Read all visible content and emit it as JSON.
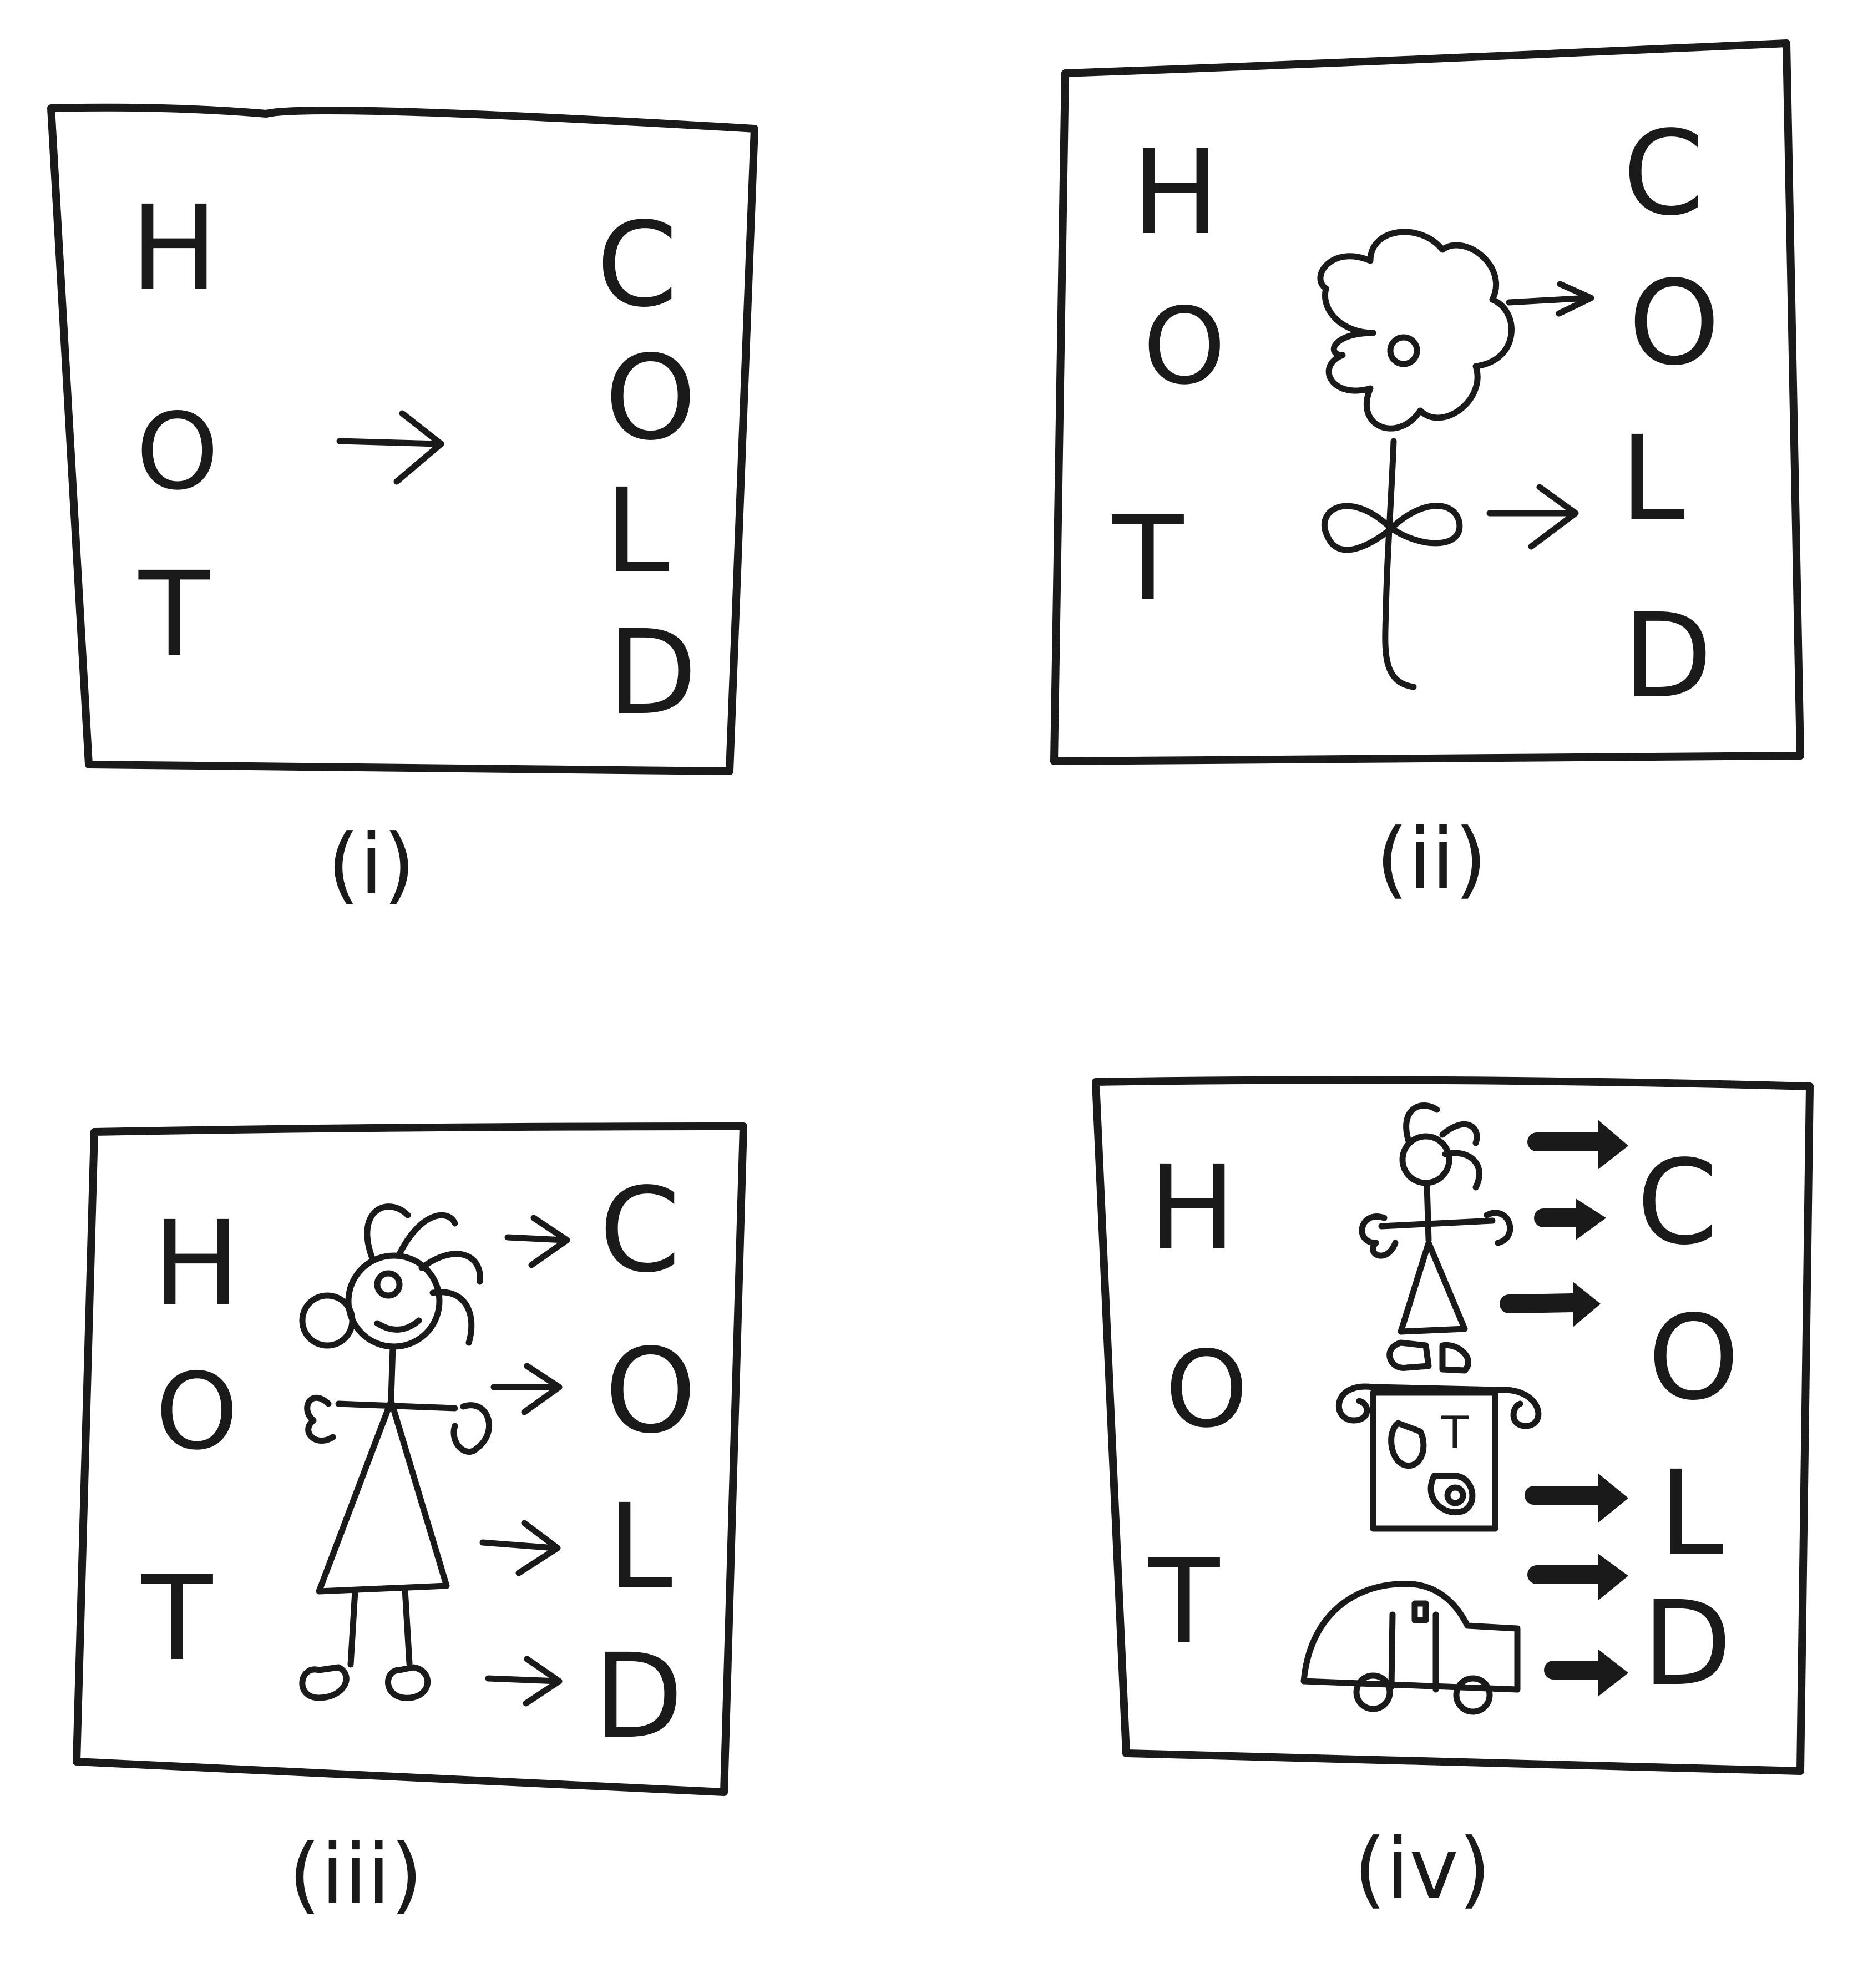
{
  "panels": [
    {
      "id": "i",
      "caption": "(i)",
      "left_letters": [
        "H",
        "O",
        "T"
      ],
      "right_letters": [
        "C",
        "O",
        "L",
        "D"
      ]
    },
    {
      "id": "ii",
      "caption": "(ii)",
      "left_letters": [
        "H",
        "O",
        "T"
      ],
      "right_letters": [
        "C",
        "O",
        "L",
        "D"
      ]
    },
    {
      "id": "iii",
      "caption": "(iii)",
      "left_letters": [
        "H",
        "O",
        "T"
      ],
      "right_letters": [
        "C",
        "O",
        "L",
        "D"
      ]
    },
    {
      "id": "iv",
      "caption": "(iv)",
      "left_letters": [
        "H",
        "O",
        "T"
      ],
      "right_letters": [
        "C",
        "O",
        "L",
        "D"
      ],
      "inner_letter": "T"
    }
  ],
  "colors": {
    "ink": "#1a1a1a",
    "background": "#ffffff"
  }
}
